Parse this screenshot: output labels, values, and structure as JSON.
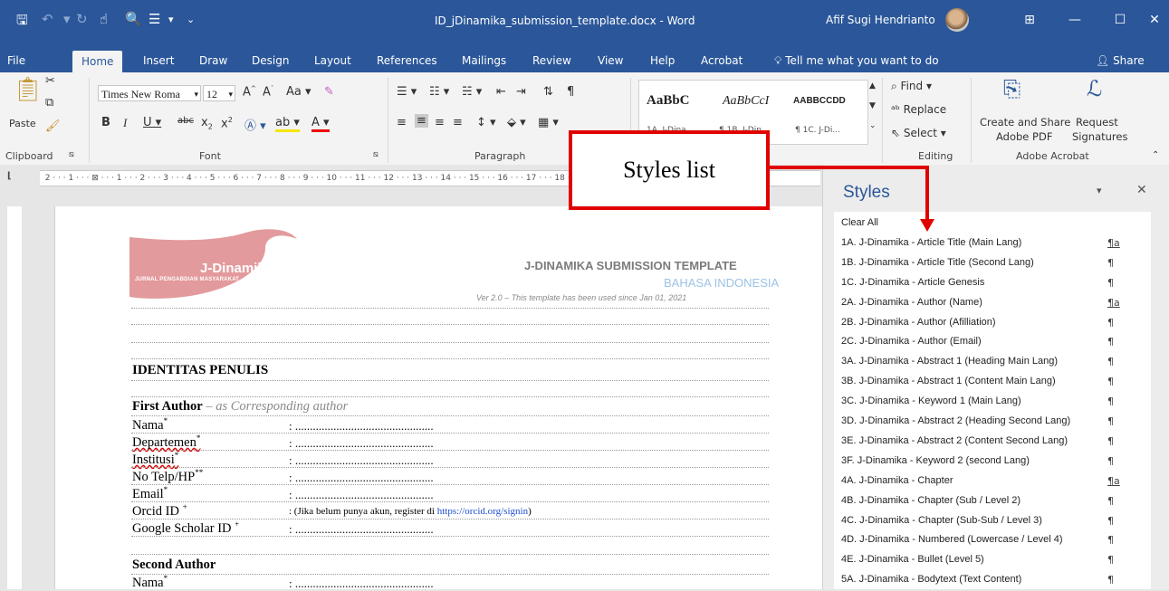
{
  "titlebar": {
    "doc_title": "ID_jDinamika_submission_template.docx  -  Word",
    "user_name": "Afif Sugi Hendrianto"
  },
  "menu": {
    "tabs": [
      "File",
      "Home",
      "Insert",
      "Draw",
      "Design",
      "Layout",
      "References",
      "Mailings",
      "Review",
      "View",
      "Help",
      "Acrobat"
    ],
    "tell_me": "Tell me what you want to do",
    "share": "Share"
  },
  "ribbon": {
    "clipboard": {
      "label": "Clipboard",
      "paste": "Paste"
    },
    "font": {
      "label": "Font",
      "font_name": "Times New Roma",
      "font_size": "12"
    },
    "paragraph": {
      "label": "Paragraph"
    },
    "styles": {
      "previews": [
        "AaBbC",
        "AaBbCcI",
        "AABBCCDD"
      ],
      "names": [
        "1A. J-Dina...",
        "¶ 1B. J-Din...",
        "¶ 1C. J-Di..."
      ]
    },
    "editing": {
      "label": "Editing",
      "find": "Find",
      "replace": "Replace",
      "select": "Select"
    },
    "acrobat": {
      "label": "Adobe Acrobat",
      "create_share": "Create and Share",
      "adobe_pdf": "Adobe PDF",
      "request": "Request",
      "signatures": "Signatures"
    }
  },
  "callout": {
    "text": "Styles list"
  },
  "document": {
    "logo_name": "J-Dinamika",
    "logo_sub": "JURNAL PENGABDIAN MASYARAKAT",
    "template_title": "J-DINAMIKA SUBMISSION TEMPLATE",
    "template_lang": "BAHASA INDONESIA",
    "template_version": "Ver 2.0 – This template has been used since Jan 01, 2021",
    "section_heading": "IDENTITAS PENULIS",
    "first_author": "First Author",
    "first_author_note": "– as Corresponding author",
    "fields": [
      {
        "label": "Nama",
        "sup": "*",
        "value": ": ..............................................."
      },
      {
        "label": "Departemen",
        "sup": "*",
        "value": ": ..............................................."
      },
      {
        "label": "Institusi",
        "sup": "*",
        "value": ": ..............................................."
      },
      {
        "label": "No Telp/HP",
        "sup": "**",
        "value": ": ..............................................."
      },
      {
        "label": "Email",
        "sup": "*",
        "value": ": ..............................................."
      },
      {
        "label": "Orcid ID",
        "sup": "+",
        "value": ": (Jika belum punya akun, register di ",
        "link": "https://orcid.org/signin",
        "value_end": ")"
      },
      {
        "label": "Google Scholar ID",
        "sup": "+",
        "value": ": ..............................................."
      }
    ],
    "second_author": "Second Author",
    "second_fields": [
      {
        "label": "Nama",
        "sup": "*",
        "value": ": ..............................................."
      }
    ]
  },
  "styles_pane": {
    "title": "Styles",
    "items": [
      {
        "label": "Clear All",
        "mark": ""
      },
      {
        "label": "1A. J-Dinamika - Article Title (Main Lang)",
        "mark": "¶a"
      },
      {
        "label": "1B. J-Dinamika - Article Title (Second Lang)",
        "mark": "¶"
      },
      {
        "label": "1C. J-Dinamika - Article Genesis",
        "mark": "¶"
      },
      {
        "label": "2A. J-Dinamika - Author (Name)",
        "mark": "¶a"
      },
      {
        "label": "2B. J-Dinamika - Author (Afilliation)",
        "mark": "¶"
      },
      {
        "label": "2C. J-Dinamika - Author (Email)",
        "mark": "¶"
      },
      {
        "label": "3A. J-Dinamika - Abstract 1 (Heading Main Lang)",
        "mark": "¶"
      },
      {
        "label": "3B. J-Dinamika - Abstract 1 (Content Main Lang)",
        "mark": "¶"
      },
      {
        "label": "3C. J-Dinamika - Keyword 1 (Main Lang)",
        "mark": "¶"
      },
      {
        "label": "3D. J-Dinamika - Abstract 2 (Heading Second Lang)",
        "mark": "¶"
      },
      {
        "label": "3E. J-Dinamika - Abstract 2 (Content Second Lang)",
        "mark": "¶"
      },
      {
        "label": "3F. J-Dinamika - Keyword 2  (second Lang)",
        "mark": "¶"
      },
      {
        "label": "4A. J-Dinamika - Chapter",
        "mark": "¶a"
      },
      {
        "label": "4B. J-Dinamika - Chapter (Sub / Level 2)",
        "mark": "¶"
      },
      {
        "label": "4C. J-Dinamika - Chapter (Sub-Sub / Level 3)",
        "mark": "¶"
      },
      {
        "label": "4D. J-Dinamika - Numbered (Lowercase / Level 4)",
        "mark": "¶"
      },
      {
        "label": "4E. J-Dinamika - Bullet (Level 5)",
        "mark": "¶"
      },
      {
        "label": "5A. J-Dinamika - Bodytext (Text Content)",
        "mark": "¶"
      }
    ]
  },
  "colors": {
    "word_blue": "#2b579a",
    "callout_red": "#e00000",
    "logo_pink": "#e39a9c"
  }
}
